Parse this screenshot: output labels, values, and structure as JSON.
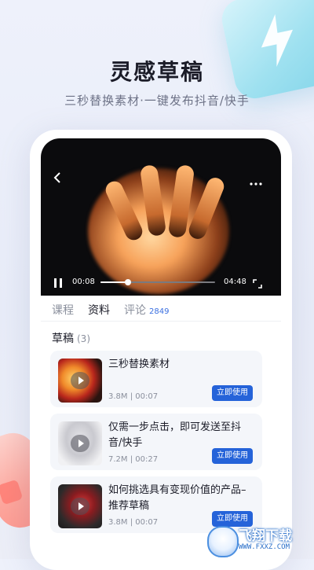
{
  "hero": {
    "title": "灵感草稿",
    "subtitle": "三秒替换素材·一键发布抖音/快手"
  },
  "player": {
    "current_time": "00:08",
    "total_time": "04:48",
    "progress": 0.24
  },
  "tabs": [
    {
      "label": "课程",
      "active": false
    },
    {
      "label": "资料",
      "active": true
    },
    {
      "label": "评论",
      "count": "2849",
      "active": false
    }
  ],
  "drafts": {
    "title": "草稿",
    "count": "(3)",
    "items": [
      {
        "title": "三秒替换素材",
        "meta": "3.8M | 00:07",
        "button": "立即使用"
      },
      {
        "title": "仅需一步点击，即可发送至抖音/快手",
        "meta": "7.2M | 00:27",
        "button": "立即使用"
      },
      {
        "title": "如何挑选具有变现价值的产品–推荐草稿",
        "meta": "3.8M | 00:07",
        "button": "立即使用"
      }
    ]
  },
  "watermark": {
    "text": "飞翔下载",
    "url": "WWW.FXXZ.COM"
  },
  "colors": {
    "accent": "#2563d9",
    "tab_count": "#3a6fe0",
    "background": "#eef1fb"
  }
}
